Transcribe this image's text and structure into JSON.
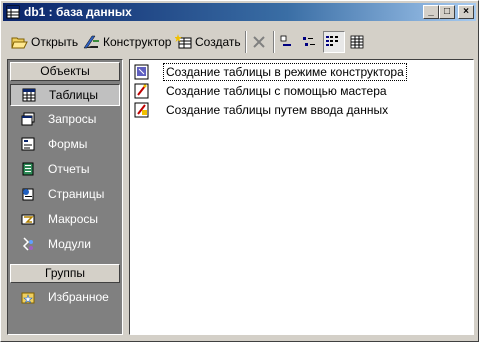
{
  "window": {
    "title": "db1 : база данных"
  },
  "title_buttons": [
    "_",
    "□",
    "×"
  ],
  "toolbar": {
    "open_label": "Открыть",
    "design_label": "Конструктор",
    "create_label": "Создать"
  },
  "objects_panel": {
    "header": "Объекты",
    "items": [
      {
        "label": "Таблицы",
        "icon": "table-icon",
        "selected": true
      },
      {
        "label": "Запросы",
        "icon": "query-icon"
      },
      {
        "label": "Формы",
        "icon": "form-icon"
      },
      {
        "label": "Отчеты",
        "icon": "report-icon"
      },
      {
        "label": "Страницы",
        "icon": "page-icon"
      },
      {
        "label": "Макросы",
        "icon": "macro-icon"
      },
      {
        "label": "Модули",
        "icon": "module-icon"
      }
    ],
    "groups_header": "Группы",
    "group_items": [
      {
        "label": "Избранное",
        "icon": "favorites-icon"
      }
    ]
  },
  "object_list": {
    "items": [
      {
        "label": "Создание таблицы в режиме конструктора",
        "icon": "design-shortcut-icon"
      },
      {
        "label": "Создание таблицы с помощью мастера",
        "icon": "wizard-shortcut-icon"
      },
      {
        "label": "Создание таблицы путем ввода данных",
        "icon": "datasheet-shortcut-icon"
      }
    ]
  }
}
